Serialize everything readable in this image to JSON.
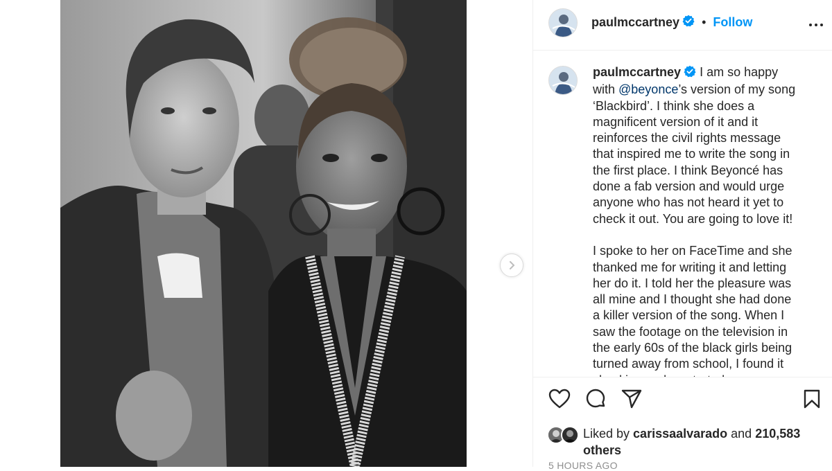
{
  "post": {
    "username": "paulmccartney",
    "follow_label": "Follow",
    "separator": "•",
    "caption": {
      "part1": "I am so happy\nwith ",
      "mention": "@beyonce",
      "part2": "’s version of my song\n‘Blackbird’. I think she does a\nmagnificent version of it and it\nreinforces the civil rights message\nthat inspired me to write the song in\nthe first place. I think Beyoncé has\ndone a fab version and would urge\nanyone who has not heard it yet to\ncheck it out. You are going to love it!\n\nI spoke to her on FaceTime and she\nthanked me for writing it and letting\nher do it. I told her the pleasure was\nall mine and I thought she had done\na killer version of the song. When I\nsaw the footage on the television in\nthe early 60s of the black girls being\nturned away from school, I found it\nshocking and so started"
    },
    "likes": {
      "prefix": "Liked by ",
      "user": "carissaalvarado",
      "middle": " and ",
      "count": "210,583",
      "suffix": "others"
    },
    "timestamp": "5 hours ago"
  },
  "icons": {
    "verified": "verified-badge-icon",
    "more": "more-options-icon",
    "like": "heart-icon",
    "comment": "comment-icon",
    "share": "share-icon",
    "save": "bookmark-icon",
    "next": "chevron-right-icon"
  },
  "colors": {
    "link": "#0095f6",
    "mention": "#00376b",
    "verified": "#0095f6",
    "text": "#262626",
    "secondary": "#8e8e8e"
  }
}
